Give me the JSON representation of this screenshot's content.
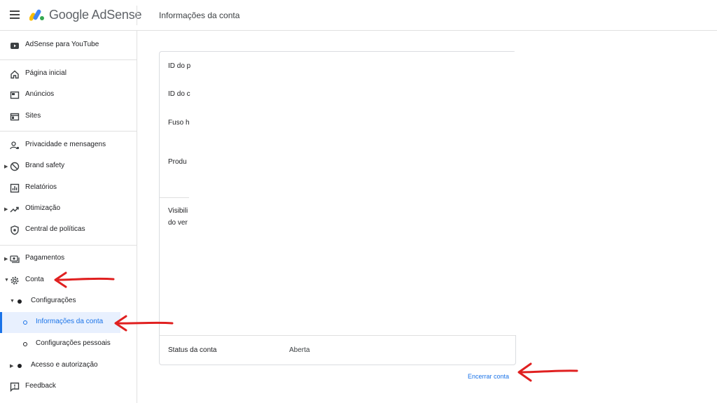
{
  "header": {
    "brand": "Google AdSense",
    "page_title": "Informações da conta"
  },
  "sidebar": {
    "youtube": "AdSense para YouTube",
    "home": "Página inicial",
    "ads": "Anúncios",
    "sites": "Sites",
    "privacy": "Privacidade e mensagens",
    "brand_safety": "Brand safety",
    "reports": "Relatórios",
    "optimization": "Otimização",
    "policy": "Central de políticas",
    "payments": "Pagamentos",
    "account": "Conta",
    "settings": "Configurações",
    "account_info": "Informações da conta",
    "personal_settings": "Configurações pessoais",
    "access": "Acesso e autorização",
    "feedback": "Feedback"
  },
  "card": {
    "row1": "ID do p",
    "row2": "ID do c",
    "row3": "Fuso h",
    "row4": "Produ",
    "row5_line1": "Visibili",
    "row5_line2": "do ver",
    "status_label": "Status da conta",
    "status_value": "Aberta"
  },
  "close_account": "Encerrar conta",
  "colors": {
    "accent": "#1a73e8",
    "annotation": "#e02020"
  }
}
